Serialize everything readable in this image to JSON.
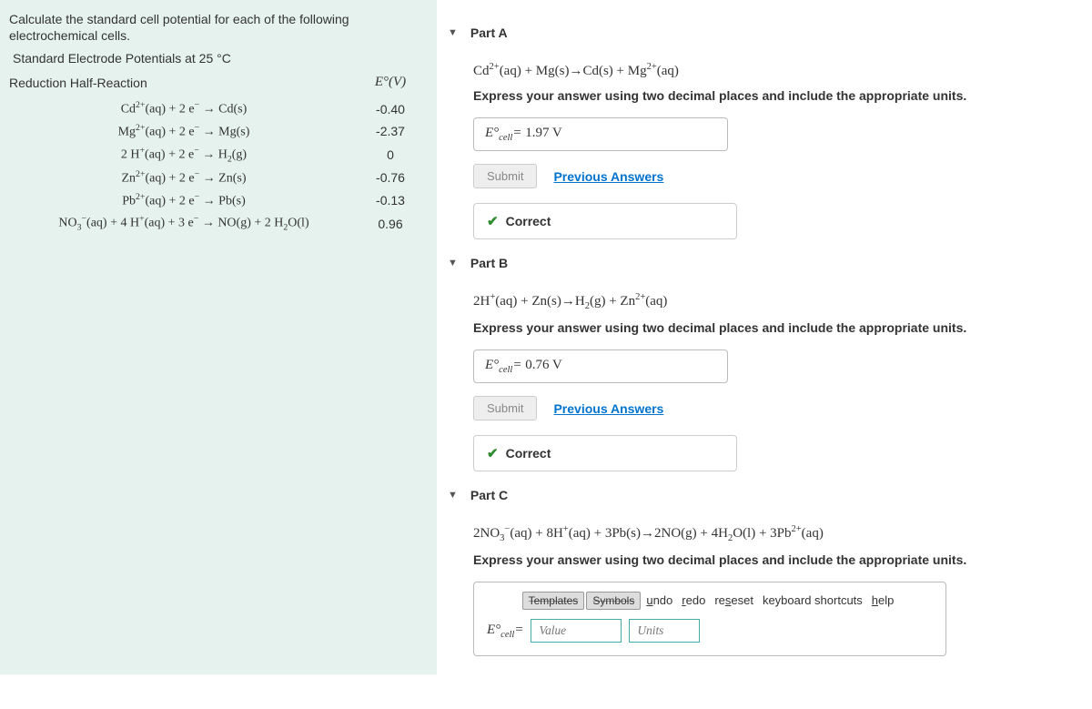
{
  "left": {
    "prompt": "Calculate the standard cell potential for each of the following electrochemical cells.",
    "ref": "Standard Electrode Potentials at 25 °C",
    "col_reaction": "Reduction Half-Reaction",
    "col_e": "E°(V)",
    "rows": [
      {
        "rxn": "Cd<sup>2+</sup>(aq) + 2 e<sup>−</sup> → Cd(s)",
        "e": "-0.40"
      },
      {
        "rxn": "Mg<sup>2+</sup>(aq) + 2 e<sup>−</sup> → Mg(s)",
        "e": "-2.37"
      },
      {
        "rxn": "2 H<sup>+</sup>(aq) + 2 e<sup>−</sup> → H<sub>2</sub>(g)",
        "e": "0"
      },
      {
        "rxn": "Zn<sup>2+</sup>(aq) + 2 e<sup>−</sup> → Zn(s)",
        "e": "-0.76"
      },
      {
        "rxn": "Pb<sup>2+</sup>(aq) + 2 e<sup>−</sup> → Pb(s)",
        "e": "-0.13"
      },
      {
        "rxn": "NO<sub>3</sub><sup>−</sup>(aq) + 4 H<sup>+</sup>(aq) + 3 e<sup>−</sup> → NO(g) + 2 H<sub>2</sub>O(l)",
        "e": "0.96"
      }
    ]
  },
  "parts": {
    "a": {
      "title": "Part A",
      "equation": "Cd<sup>2+</sup>(aq) + Mg(s)→Cd(s) + Mg<sup>2+</sup>(aq)",
      "instruction": "Express your answer using two decimal places and include the appropriate units.",
      "answer_label": "E°<sub>cell</sub>=",
      "answer_value": "1.97 V",
      "submit": "Submit",
      "prev": "Previous Answers",
      "feedback": "Correct"
    },
    "b": {
      "title": "Part B",
      "equation": "2H<sup>+</sup>(aq) + Zn(s)→H<sub>2</sub>(g) + Zn<sup>2+</sup>(aq)",
      "instruction": "Express your answer using two decimal places and include the appropriate units.",
      "answer_label": "E°<sub>cell</sub>=",
      "answer_value": "0.76 V",
      "submit": "Submit",
      "prev": "Previous Answers",
      "feedback": "Correct"
    },
    "c": {
      "title": "Part C",
      "equation": "2NO<sub>3</sub><sup>−</sup>(aq) + 8H<sup>+</sup>(aq) + 3Pb(s)→2NO(g) + 4H<sub>2</sub>O(l) + 3Pb<sup>2+</sup>(aq)",
      "instruction": "Express your answer using two decimal places and include the appropriate units.",
      "answer_label": "E°<sub>cell</sub>=",
      "value_ph": "Value",
      "units_ph": "Units",
      "toolbar": {
        "templates": "Templates",
        "symbols": "Symbols",
        "undo": "undo",
        "redo": "redo",
        "reset": "reset",
        "kb": "keyboard shortcuts",
        "help": "help"
      }
    }
  }
}
